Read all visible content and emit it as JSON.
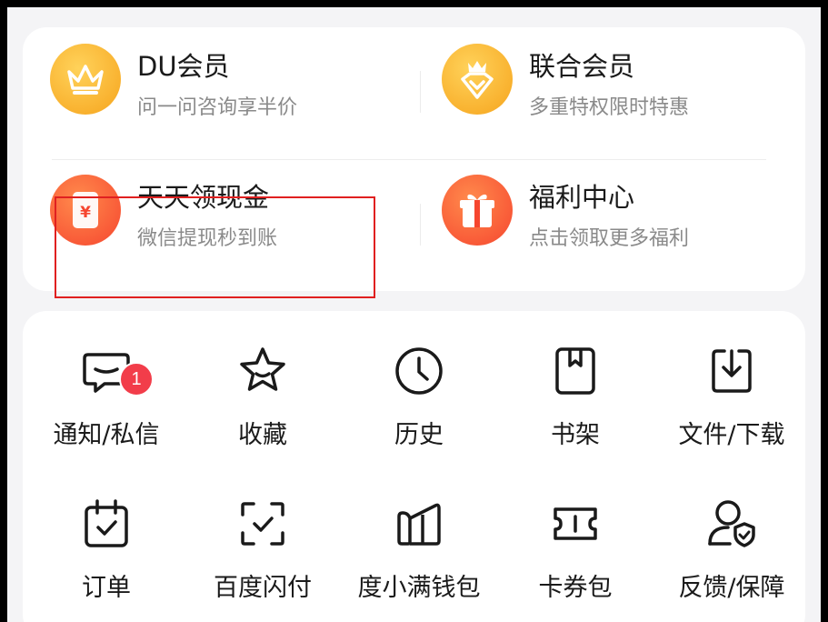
{
  "promos": [
    {
      "title": "DU会员",
      "subtitle": "问一问咨询享半价",
      "icon": "crown-icon"
    },
    {
      "title": "联合会员",
      "subtitle": "多重特权限时特惠",
      "icon": "gem-crown-icon"
    },
    {
      "title": "天天领现金",
      "subtitle": "微信提现秒到账",
      "icon": "yuan-envelope-icon"
    },
    {
      "title": "福利中心",
      "subtitle": "点击领取更多福利",
      "icon": "gift-icon"
    }
  ],
  "grid": [
    {
      "label": "通知/私信",
      "icon": "message-icon",
      "badge": "1"
    },
    {
      "label": "收藏",
      "icon": "star-icon"
    },
    {
      "label": "历史",
      "icon": "clock-icon"
    },
    {
      "label": "书架",
      "icon": "bookmark-book-icon"
    },
    {
      "label": "文件/下载",
      "icon": "download-icon"
    },
    {
      "label": "订单",
      "icon": "calendar-check-icon"
    },
    {
      "label": "百度闪付",
      "icon": "scan-check-icon"
    },
    {
      "label": "度小满钱包",
      "icon": "wallet-icon"
    },
    {
      "label": "卡券包",
      "icon": "ticket-icon"
    },
    {
      "label": "反馈/保障",
      "icon": "user-shield-icon"
    }
  ],
  "colors": {
    "gold": "#f9b52c",
    "red_orange": "#fb5b3d",
    "highlight": "#e02020",
    "badge": "#f23d4a"
  }
}
